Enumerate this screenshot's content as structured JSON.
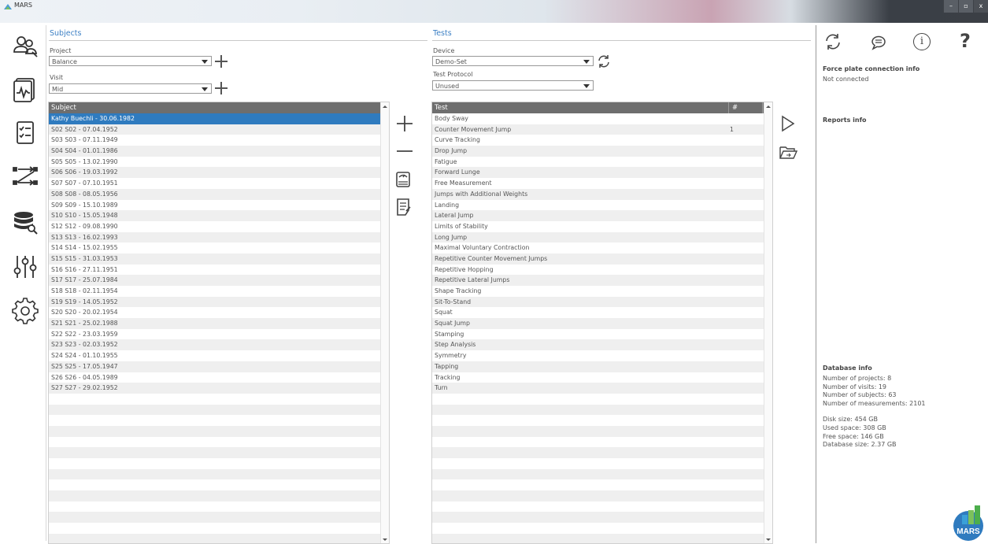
{
  "app": {
    "title": "MARS"
  },
  "window_buttons": {
    "minimize": "–",
    "maximize": "▫",
    "close": "x"
  },
  "nav": {
    "items": [
      {
        "icon": "subjects-icon"
      },
      {
        "icon": "measurements-icon"
      },
      {
        "icon": "checklist-icon"
      },
      {
        "icon": "workflow-icon"
      },
      {
        "icon": "database-search-icon"
      },
      {
        "icon": "sliders-icon"
      },
      {
        "icon": "gear-icon"
      }
    ]
  },
  "subjects": {
    "title": "Subjects",
    "project_label": "Project",
    "project_value": "Balance",
    "visit_label": "Visit",
    "visit_value": "Mid",
    "list_header": "Subject",
    "rows": [
      "Kathy Buechli - 30.06.1982",
      "S02 S02 - 07.04.1952",
      "S03 S03 - 07.11.1949",
      "S04 S04 - 01.01.1986",
      "S05 S05 - 13.02.1990",
      "S06 S06 - 19.03.1992",
      "S07 S07 - 07.10.1951",
      "S08 S08 - 08.05.1956",
      "S09 S09 - 15.10.1989",
      "S10 S10 - 15.05.1948",
      "S12 S12 - 09.08.1990",
      "S13 S13 - 16.02.1993",
      "S14 S14 - 15.02.1955",
      "S15 S15 - 31.03.1953",
      "S16 S16 - 27.11.1951",
      "S17 S17 - 25.07.1984",
      "S18 S18 - 02.11.1954",
      "S19 S19 - 14.05.1952",
      "S20 S20 - 20.02.1954",
      "S21 S21 - 25.02.1988",
      "S22 S22 - 23.03.1959",
      "S23 S23 - 02.03.1952",
      "S24 S24 - 01.10.1955",
      "S25 S25 - 17.05.1947",
      "S26 S26 - 04.05.1989",
      "S27 S27 - 29.02.1952"
    ],
    "selected_index": 0
  },
  "tests": {
    "title": "Tests",
    "device_label": "Device",
    "device_value": "Demo-Set",
    "protocol_label": "Test Protocol",
    "protocol_value": "Unused",
    "list_header": "Test",
    "count_header": "#",
    "rows": [
      {
        "name": "Body Sway",
        "count": ""
      },
      {
        "name": "Counter Movement Jump",
        "count": "1"
      },
      {
        "name": "Curve Tracking",
        "count": ""
      },
      {
        "name": "Drop Jump",
        "count": ""
      },
      {
        "name": "Fatigue",
        "count": ""
      },
      {
        "name": "Forward Lunge",
        "count": ""
      },
      {
        "name": "Free Measurement",
        "count": ""
      },
      {
        "name": "Jumps with Additional Weights",
        "count": ""
      },
      {
        "name": "Landing",
        "count": ""
      },
      {
        "name": "Lateral Jump",
        "count": ""
      },
      {
        "name": "Limits of Stability",
        "count": ""
      },
      {
        "name": "Long Jump",
        "count": ""
      },
      {
        "name": "Maximal Voluntary Contraction",
        "count": ""
      },
      {
        "name": "Repetitive Counter Movement Jumps",
        "count": ""
      },
      {
        "name": "Repetitive Hopping",
        "count": ""
      },
      {
        "name": "Repetitive Lateral Jumps",
        "count": ""
      },
      {
        "name": "Shape Tracking",
        "count": ""
      },
      {
        "name": "Sit-To-Stand",
        "count": ""
      },
      {
        "name": "Squat",
        "count": ""
      },
      {
        "name": "Squat Jump",
        "count": ""
      },
      {
        "name": "Stamping",
        "count": ""
      },
      {
        "name": "Step Analysis",
        "count": ""
      },
      {
        "name": "Symmetry",
        "count": ""
      },
      {
        "name": "Tapping",
        "count": ""
      },
      {
        "name": "Tracking",
        "count": ""
      },
      {
        "name": "Turn",
        "count": ""
      }
    ]
  },
  "info": {
    "force_plate_title": "Force plate connection info",
    "force_plate_status": "Not connected",
    "reports_title": "Reports info",
    "database_title": "Database info",
    "projects": "Number of projects: 8",
    "visits": "Number of visits: 19",
    "subjects": "Number of subjects: 63",
    "measurements": "Number of measurements: 2101",
    "disk_size": "Disk size: 454 GB",
    "used_space": "Used space: 308 GB",
    "free_space": "Free space: 146 GB",
    "database_size": "Database size: 2.37 GB",
    "help_symbol": "?",
    "info_symbol": "i"
  },
  "logo": {
    "text": "MARS"
  },
  "colors": {
    "accent": "#3b7fc4",
    "selected": "#2f7bbf",
    "header": "#6e6e6e"
  }
}
